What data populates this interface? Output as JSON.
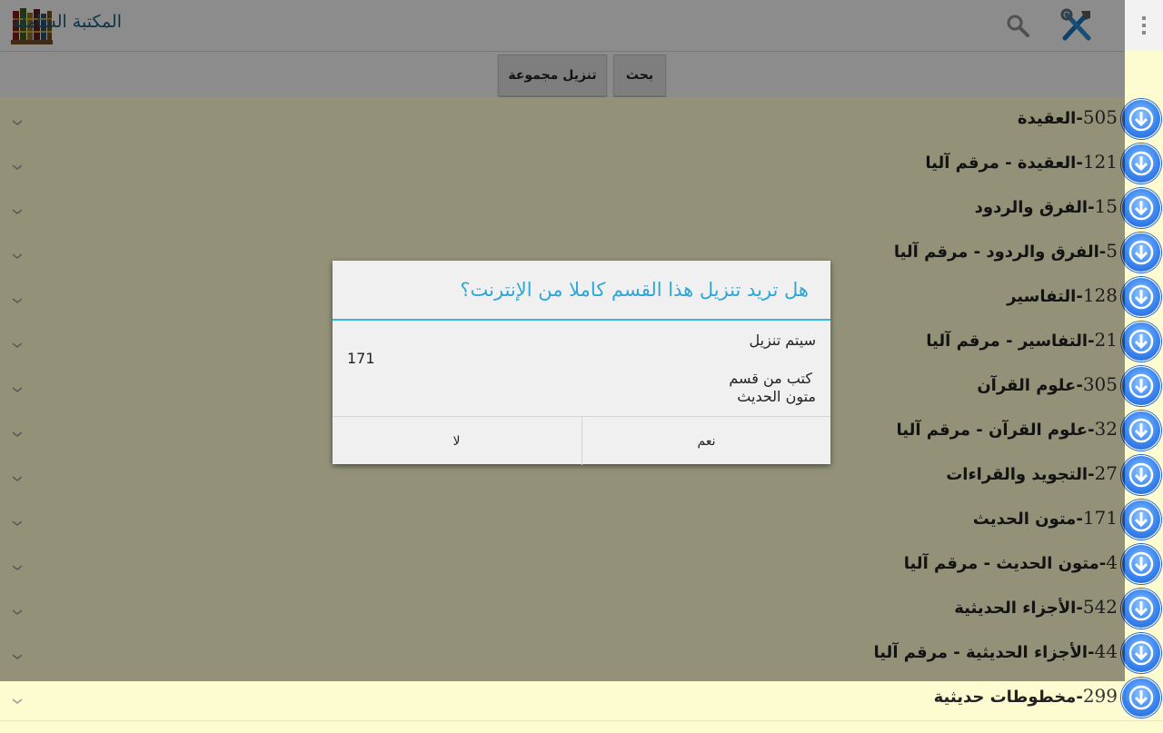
{
  "app": {
    "title": "المكتبة الشاملة"
  },
  "toolbar": {
    "search_label": "بحث",
    "download_group_label": "تنزيل مجموعة"
  },
  "categories": [
    {
      "count": "505",
      "name": "العقيدة"
    },
    {
      "count": "121",
      "name": "العقيدة - مرقم آليا"
    },
    {
      "count": "15",
      "name": "الفرق والردود"
    },
    {
      "count": "5",
      "name": "الفرق والردود - مرقم آليا"
    },
    {
      "count": "128",
      "name": "التفاسير"
    },
    {
      "count": "21",
      "name": "التفاسير - مرقم آليا"
    },
    {
      "count": "305",
      "name": "علوم القرآن"
    },
    {
      "count": "32",
      "name": "علوم القرآن - مرقم آليا"
    },
    {
      "count": "27",
      "name": "التجويد والقراءات"
    },
    {
      "count": "171",
      "name": "متون الحديث"
    },
    {
      "count": "4",
      "name": "متون الحديث - مرقم آليا"
    },
    {
      "count": "542",
      "name": "الأجزاء الحديثية"
    },
    {
      "count": "44",
      "name": "الأجزاء الحديثية - مرقم آليا"
    },
    {
      "count": "299",
      "name": "مخطوطات حديثية"
    }
  ],
  "dialog": {
    "title": "هل تريد تنزيل هذا القسم كاملا من الإنترنت؟",
    "line1": "سيتم تنزيل",
    "count": "171",
    "line2": "كتب من قسم",
    "line3": "متون الحديث",
    "yes_label": "نعم",
    "no_label": "لا"
  },
  "colors": {
    "accent": "#33b5e5",
    "row_bg": "#fdfcd0",
    "title_blue": "#2fa7d6"
  }
}
